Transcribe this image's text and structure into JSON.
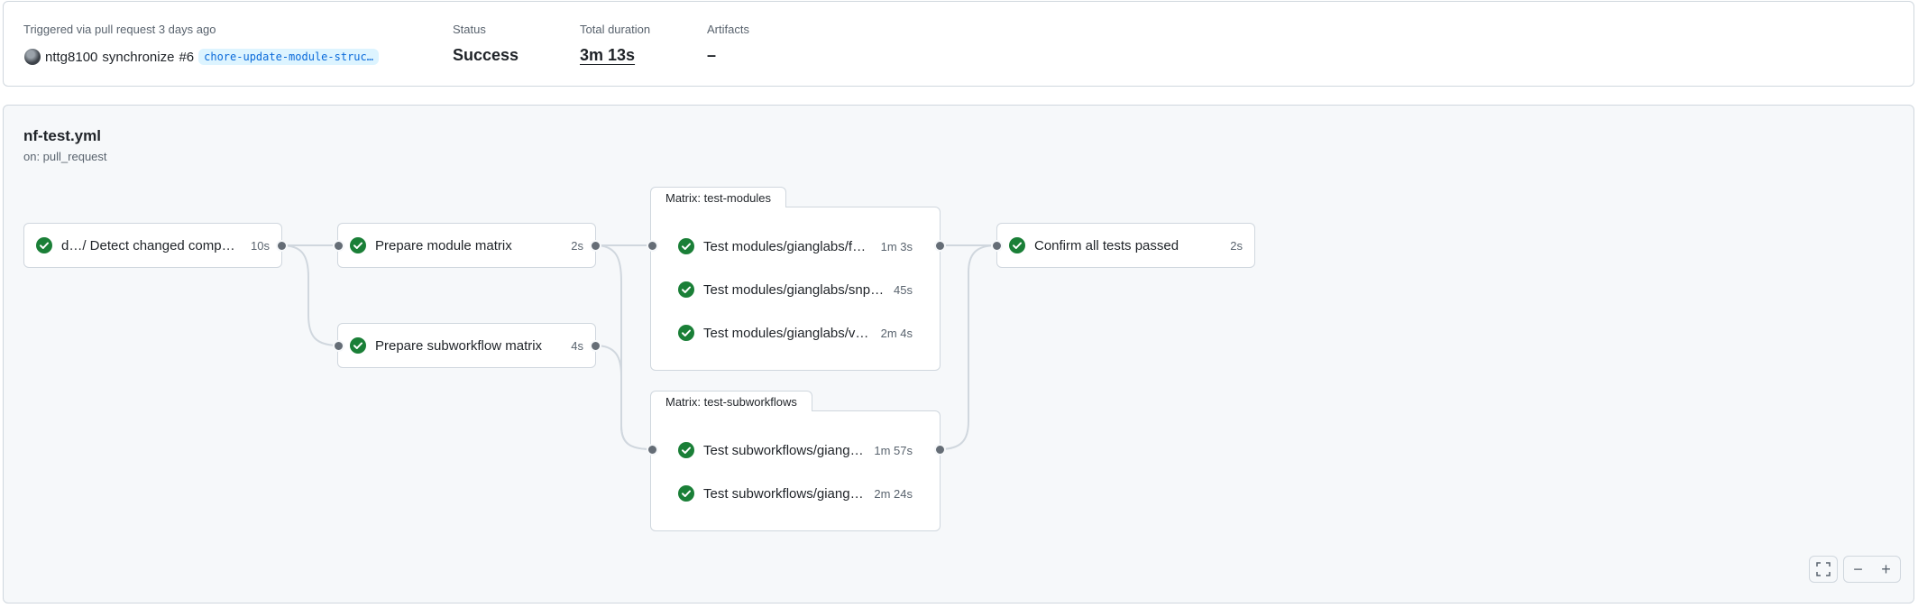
{
  "summary": {
    "trigger_label": "Triggered via pull request 3 days ago",
    "user": "nttg8100",
    "action": "synchronize",
    "pr_number": "#6",
    "branch": "chore-update-module-struc…",
    "status_label": "Status",
    "status_value": "Success",
    "duration_label": "Total duration",
    "duration_value": "3m 13s",
    "artifacts_label": "Artifacts",
    "artifacts_value": "–"
  },
  "workflow": {
    "file": "nf-test.yml",
    "event": "on: pull_request"
  },
  "jobs": [
    {
      "name": "d…/ Detect changed compo…",
      "duration": "10s",
      "status": "success"
    },
    {
      "name": "Prepare module matrix",
      "duration": "2s",
      "status": "success"
    },
    {
      "name": "Prepare subworkflow matrix",
      "duration": "4s",
      "status": "success"
    },
    {
      "name": "Confirm all tests passed",
      "duration": "2s",
      "status": "success"
    }
  ],
  "matrices": [
    {
      "title": "Matrix: test-modules",
      "items": [
        {
          "name": "Test modules/gianglabs/f…",
          "duration": "1m 3s"
        },
        {
          "name": "Test modules/gianglabs/snp…",
          "duration": "45s"
        },
        {
          "name": "Test modules/gianglabs/v…",
          "duration": "2m 4s"
        }
      ]
    },
    {
      "title": "Matrix: test-subworkflows",
      "items": [
        {
          "name": "Test subworkflows/giang…",
          "duration": "1m 57s"
        },
        {
          "name": "Test subworkflows/giang…",
          "duration": "2m 24s"
        }
      ]
    }
  ],
  "controls": {
    "fullscreen_icon": "fullscreen-icon",
    "zoom_out_icon": "minus-icon",
    "zoom_in_icon": "plus-icon"
  },
  "colors": {
    "success": "#1a7f37",
    "border": "#d0d7de",
    "wire": "#d0d7de",
    "port": "#656d76"
  }
}
